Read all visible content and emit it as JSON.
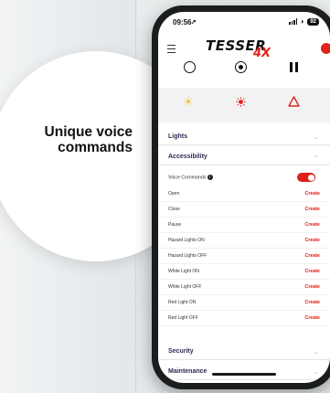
{
  "overlay": {
    "headline": [
      "Unique voice",
      "commands"
    ]
  },
  "status_bar": {
    "time": "09:56",
    "battery": "92"
  },
  "header": {
    "logo_text": "TESSER",
    "logo_suffix": "4X"
  },
  "colors": {
    "accent_red": "#dc2119",
    "section_text": "#2b2b52",
    "sun_icon": "#f4c430",
    "hazard_icon": "#e0251b"
  },
  "controls": [
    "stop-icon",
    "record-icon",
    "pause-icon"
  ],
  "mode_icons": [
    "dim-light-icon",
    "bright-light-icon",
    "hazard-icon"
  ],
  "sections": {
    "lights": "Lights",
    "accessibility": "Accessibility",
    "security": "Security",
    "maintenance": "Maintenance"
  },
  "voice_commands": {
    "label": "Voice Commands",
    "enabled": true
  },
  "commands": [
    {
      "label": "Open",
      "action": "Create"
    },
    {
      "label": "Close",
      "action": "Create"
    },
    {
      "label": "Pause",
      "action": "Create"
    },
    {
      "label": "Hazard Lights ON",
      "action": "Create"
    },
    {
      "label": "Hazard Lights OFF",
      "action": "Create"
    },
    {
      "label": "White Light ON",
      "action": "Create"
    },
    {
      "label": "White Light OFF",
      "action": "Create"
    },
    {
      "label": "Red Light ON",
      "action": "Create"
    },
    {
      "label": "Red Light OFF",
      "action": "Create"
    }
  ]
}
